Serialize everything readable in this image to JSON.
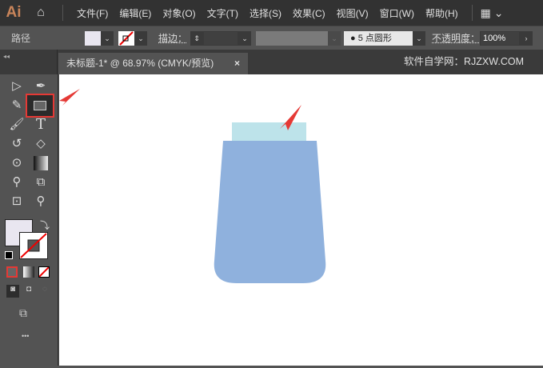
{
  "app": {
    "logo": "Ai"
  },
  "menu": [
    "文件(F)",
    "编辑(E)",
    "对象(O)",
    "文字(T)",
    "选择(S)",
    "效果(C)",
    "视图(V)",
    "窗口(W)",
    "帮助(H)"
  ],
  "control": {
    "selection": "路径",
    "stroke_label": "描边：",
    "brush": "5 点圆形",
    "opacity_label": "不透明度：",
    "opacity": "100%"
  },
  "tab": {
    "title": "未标题-1* @ 68.97% (CMYK/预览)",
    "close": "×"
  },
  "watermark": "软件自学网：RJZXW.COM",
  "toolbar": {
    "more": "•••"
  },
  "colors": {
    "lid": "#bde3ea",
    "bottle": "#8fb1dd",
    "highlight": "#e53935"
  }
}
